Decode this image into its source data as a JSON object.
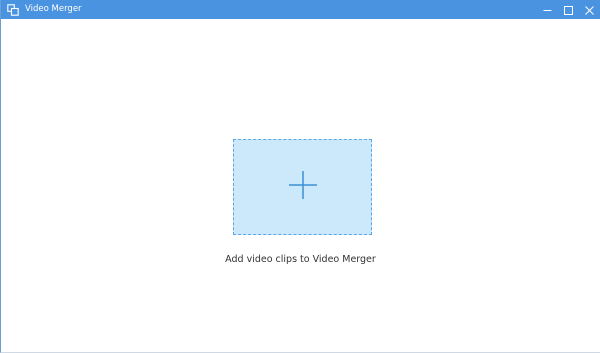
{
  "window": {
    "title": "Video Merger",
    "icon": "video-merger-icon",
    "titlebar_color": "#4a93e0",
    "controls": [
      {
        "name": "minimize-icon"
      },
      {
        "name": "maximize-icon"
      },
      {
        "name": "close-icon"
      }
    ]
  },
  "main": {
    "drop_zone": {
      "icon": "plus-icon",
      "background": "#cce9fc",
      "border_color": "#5aa6e6"
    },
    "drop_label": "Add video clips to Video Merger"
  }
}
